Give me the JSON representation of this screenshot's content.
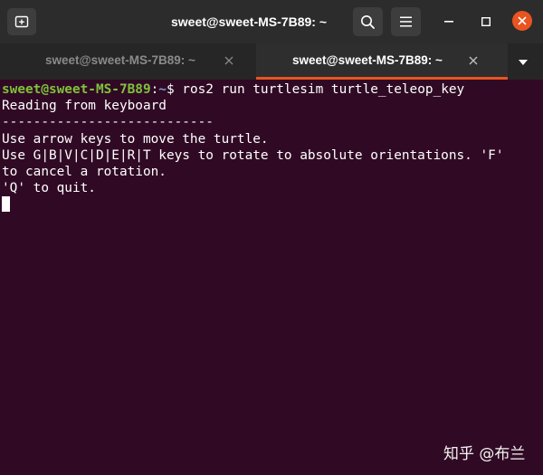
{
  "window": {
    "title": "sweet@sweet-MS-7B89: ~"
  },
  "titlebar": {
    "new_tab_icon": "new-tab-icon",
    "search_icon": "search-icon",
    "menu_icon": "hamburger-menu-icon",
    "minimize_icon": "minimize-icon",
    "maximize_icon": "maximize-icon",
    "close_icon": "close-icon"
  },
  "tabs": [
    {
      "label": "sweet@sweet-MS-7B89: ~",
      "active": false
    },
    {
      "label": "sweet@sweet-MS-7B89: ~",
      "active": true
    }
  ],
  "colors": {
    "terminal_bg": "#300a24",
    "accent": "#e95420",
    "prompt_user": "#7fc23c",
    "prompt_path": "#7b9fd4"
  },
  "terminal": {
    "prompt_user": "sweet@sweet-MS-7B89",
    "prompt_sep": ":",
    "prompt_path": "~",
    "command": "$ ros2 run turtlesim turtle_teleop_key",
    "output": [
      "Reading from keyboard",
      "---------------------------",
      "Use arrow keys to move the turtle.",
      "Use G|B|V|C|D|E|R|T keys to rotate to absolute orientations. 'F'",
      "to cancel a rotation.",
      "'Q' to quit."
    ]
  },
  "watermark": "知乎 @布兰"
}
